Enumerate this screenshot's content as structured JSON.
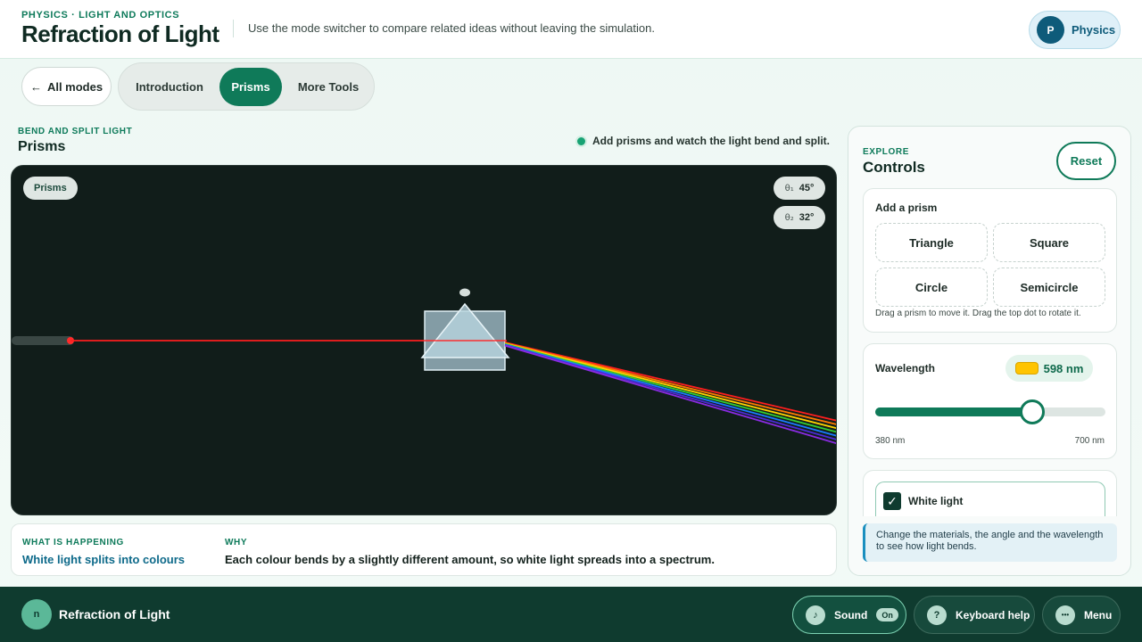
{
  "header": {
    "eyebrow": "PHYSICS · LIGHT AND OPTICS",
    "title": "Refraction of Light",
    "description": "Use the mode switcher to compare related ideas without leaving the simulation.",
    "subject": {
      "initial": "P",
      "label": "Physics"
    }
  },
  "modes": {
    "back_label": "All modes",
    "tabs": [
      {
        "label": "Introduction",
        "active": false
      },
      {
        "label": "Prisms",
        "active": true
      },
      {
        "label": "More Tools",
        "active": false
      }
    ]
  },
  "sim": {
    "eyebrow": "BEND AND SPLIT LIGHT",
    "title": "Prisms",
    "hint": "Add prisms and watch the light bend and split.",
    "mode_pill": "Prisms",
    "angles": [
      {
        "symbol": "θ₁",
        "value": "45°"
      },
      {
        "symbol": "θ₂",
        "value": "32°"
      }
    ],
    "beam_colors": [
      "#ff1e1e",
      "#ff7a00",
      "#ffd400",
      "#33cc33",
      "#1a7bff",
      "#4b2bd6",
      "#8a2be2"
    ]
  },
  "info": {
    "what_label": "WHAT IS HAPPENING",
    "what_value": "White light splits into colours",
    "why_label": "WHY",
    "why_value": "Each colour bends by a slightly different amount, so white light spreads into a spectrum."
  },
  "panel": {
    "eyebrow": "EXPLORE",
    "title": "Controls",
    "reset_label": "Reset",
    "add_prism": {
      "title": "Add a prism",
      "shapes": [
        "Triangle",
        "Square",
        "Circle",
        "Semicircle"
      ],
      "note": "Drag a prism to move it. Drag the top dot to rotate it."
    },
    "wavelength": {
      "title": "Wavelength",
      "value_label": "598 nm",
      "value": 598,
      "min": 380,
      "max": 700,
      "min_label": "380 nm",
      "max_label": "700 nm",
      "swatch_color": "#ffc400"
    },
    "white_light": {
      "label": "White light",
      "checked": true
    },
    "callout": "Change the materials, the angle and the wavelength to see how light bends."
  },
  "footer": {
    "logo": "n",
    "title": "Refraction of Light",
    "buttons": [
      {
        "label": "Sound",
        "icon": "♪",
        "badge": "On"
      },
      {
        "label": "Keyboard help",
        "icon": "?"
      },
      {
        "label": "Menu",
        "icon": "•••"
      }
    ]
  }
}
